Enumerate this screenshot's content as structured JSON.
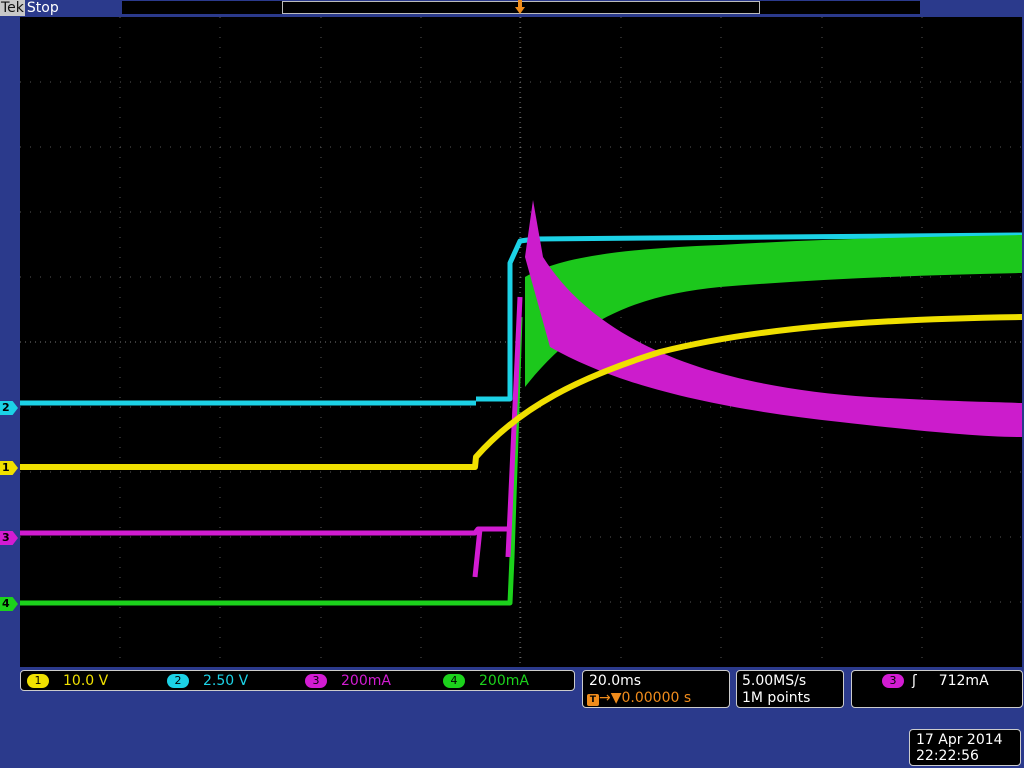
{
  "header": {
    "brand": "Tek",
    "run_state": "Stop",
    "trigger_position_marker": "T"
  },
  "channels": [
    {
      "id": "1",
      "scale": "10.0 V",
      "color": "#f0e000"
    },
    {
      "id": "2",
      "scale": "2.50 V",
      "color": "#1cd2e6"
    },
    {
      "id": "3",
      "scale": "200mA",
      "color": "#d21cd2"
    },
    {
      "id": "4",
      "scale": "200mA",
      "color": "#1cd21c"
    }
  ],
  "horizontal": {
    "time_per_div": "20.0ms",
    "trigger_delay_icon": "T",
    "trigger_delay": "0.00000 s"
  },
  "acquisition": {
    "sample_rate": "5.00MS/s",
    "record_length": "1M points"
  },
  "trigger": {
    "source": "3",
    "slope": "rising-edge-icon",
    "level": "712mA"
  },
  "datetime": {
    "date": "17 Apr 2014",
    "time": "22:22:56"
  }
}
